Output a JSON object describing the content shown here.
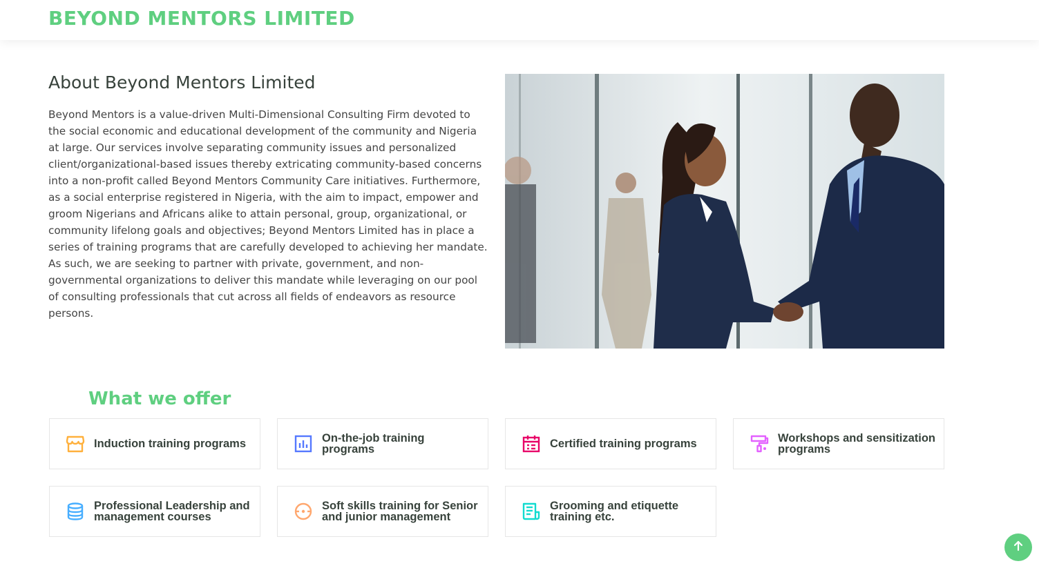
{
  "header": {
    "logo_text": "BEYOND MENTORS LIMITED"
  },
  "about": {
    "title": "About Beyond Mentors Limited",
    "paragraph": "Beyond Mentors is a value-driven Multi-Dimensional Consulting Firm devoted to the social economic and educational development of the community and Nigeria at large. Our services involve separating community issues and personalized client/organizational-based issues thereby extricating community-based concerns into a non-profit called Beyond Mentors Community Care initiatives. Furthermore, as a social enterprise registered in Nigeria, with the aim to impact, empower and groom Nigerians and Africans alike to attain personal, group, organizational, or community lifelong goals and objectives; Beyond Mentors Limited has in place a series of training programs that are carefully developed to achieving her mandate. As such, we are seeking to partner with private, government, and non-governmental organizations to deliver this mandate while leveraging on our pool of consulting professionals that cut across all fields of endeavors as resource persons.",
    "image": "business-handshake-photo"
  },
  "offer": {
    "title": "What we offer",
    "items": [
      {
        "label": "Induction training programs",
        "icon": "store-icon",
        "color": "#ffb03b"
      },
      {
        "label": "On-the-job training programs",
        "icon": "bar-chart-icon",
        "color": "#5578ff"
      },
      {
        "label": "Certified training programs",
        "icon": "calendar-icon",
        "color": "#e80368"
      },
      {
        "label": "Workshops and sensitization programs",
        "icon": "paint-roller-icon",
        "color": "#e361ff"
      },
      {
        "label": "Professional Leadership and management courses",
        "icon": "database-icon",
        "color": "#47aeff"
      },
      {
        "label": "Soft skills training for Senior and junior management",
        "icon": "gradienter-icon",
        "color": "#ffa76e"
      },
      {
        "label": "Grooming and etiquette training etc.",
        "icon": "file-list-icon",
        "color": "#11dbcf"
      }
    ]
  },
  "back_to_top": {
    "icon": "arrow-up-icon",
    "color": "#5fcf80"
  }
}
